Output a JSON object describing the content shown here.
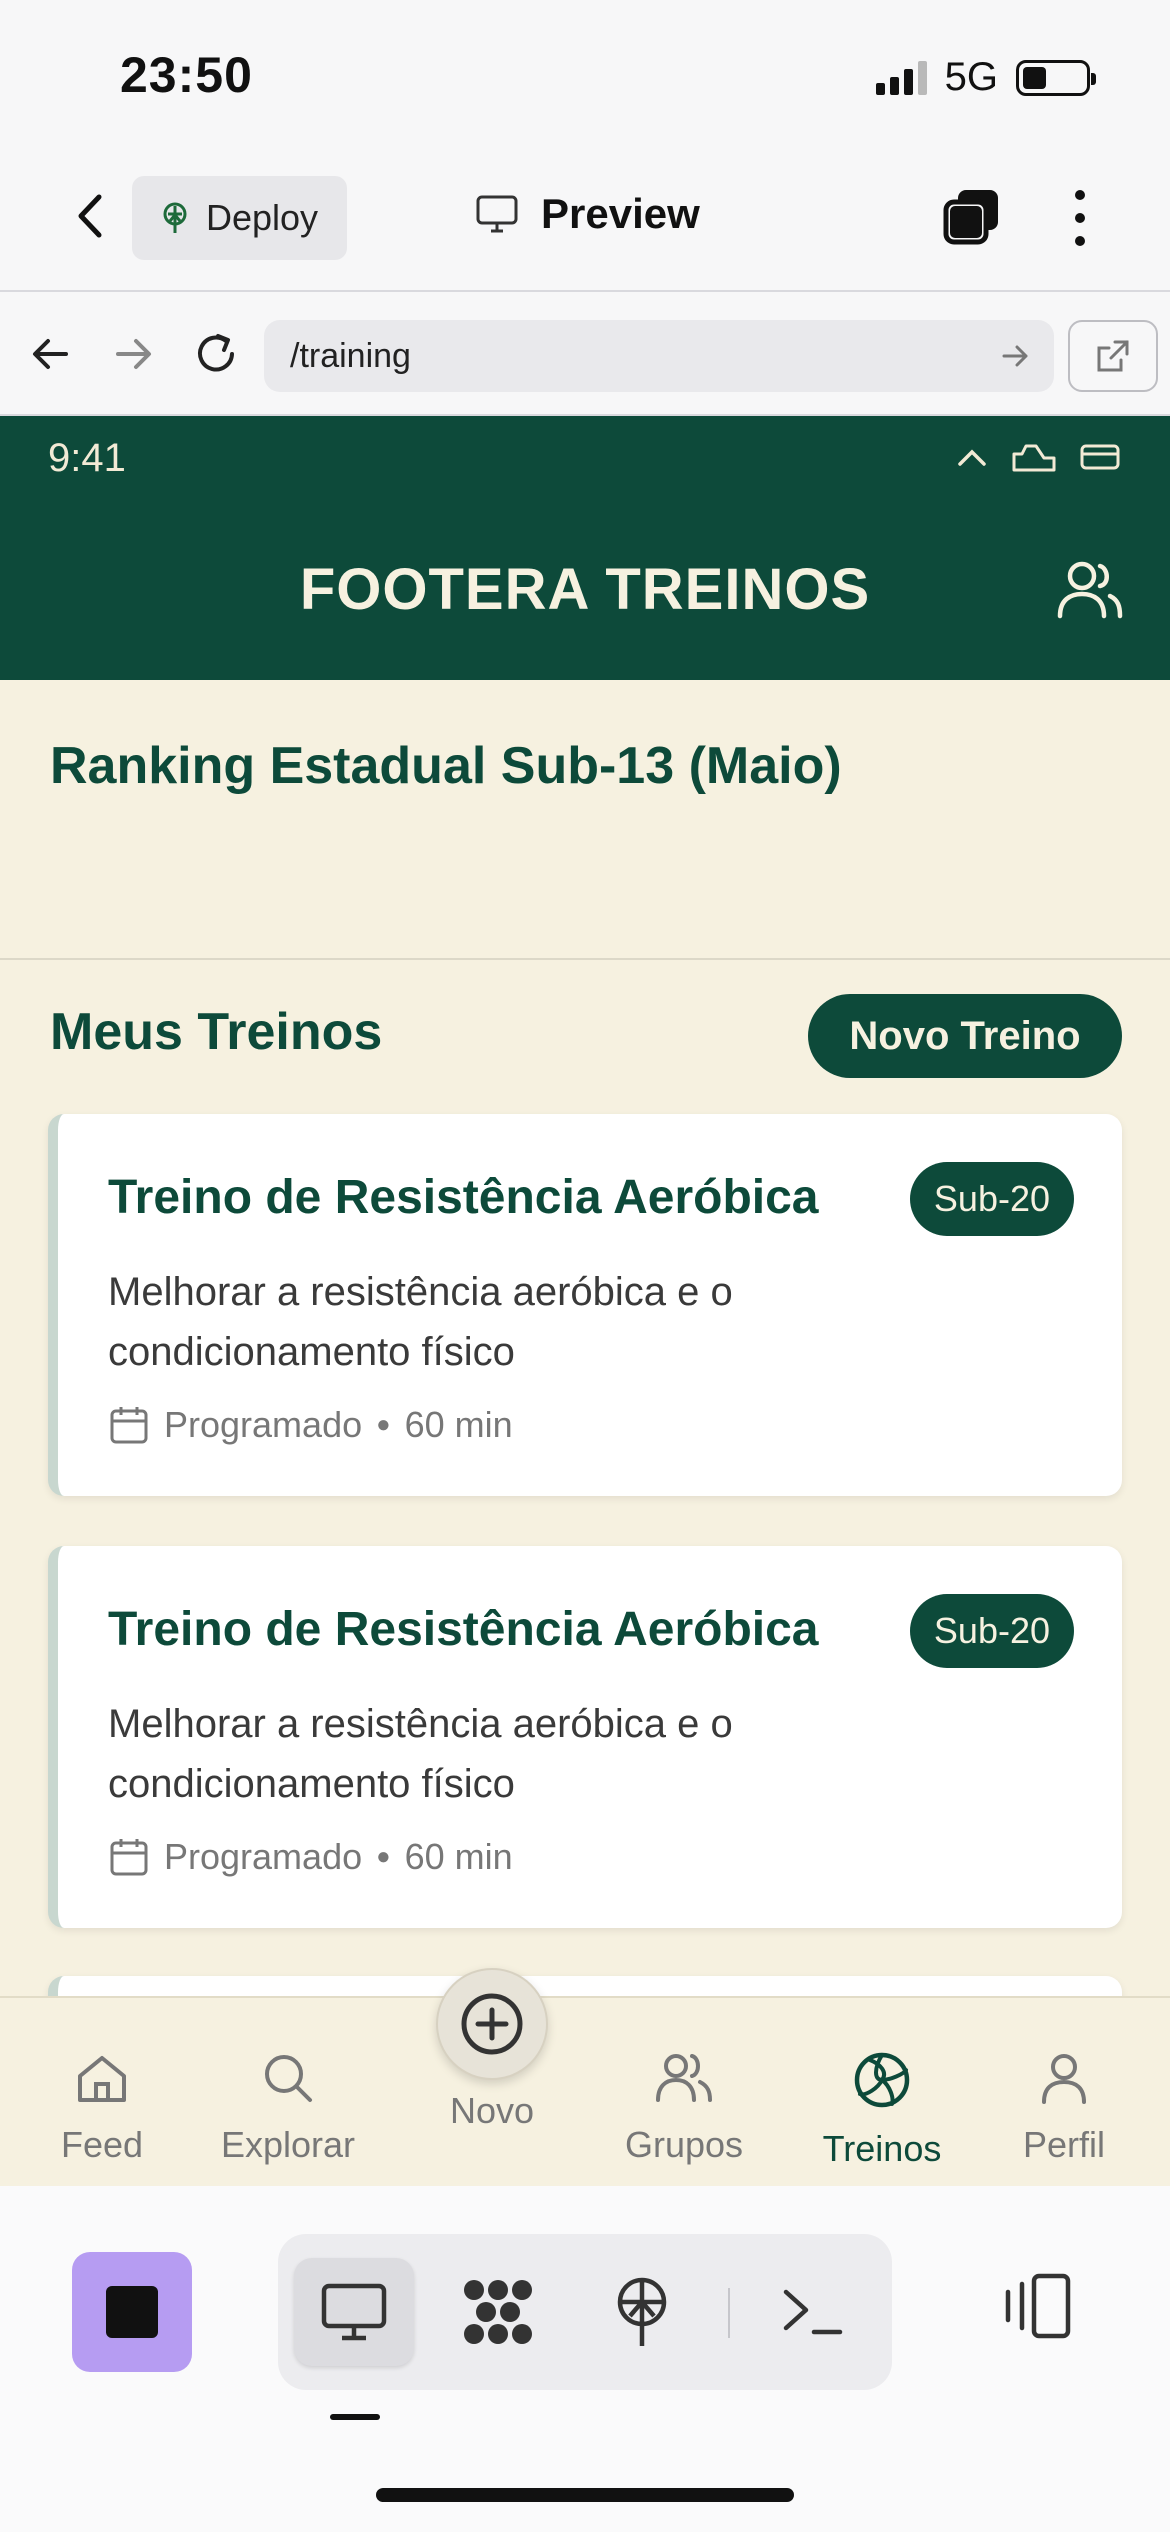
{
  "ios_status": {
    "time": "23:50",
    "network": "5G"
  },
  "toolbar": {
    "deploy_label": "Deploy",
    "preview_label": "Preview"
  },
  "urlbar": {
    "url": "/training"
  },
  "app": {
    "sim_time": "9:41",
    "title": "FOOTERA TREINOS",
    "ranking_title": "Ranking Estadual Sub-13 (Maio)",
    "section_title": "Meus Treinos",
    "new_button": "Novo Treino",
    "cards": [
      {
        "title": "Treino de Resistência Aeróbica",
        "badge": "Sub-20",
        "desc": "Melhorar a resistência aeróbica e o condicionamento físico",
        "status": "Programado",
        "duration": "60 min"
      },
      {
        "title": "Treino de Resistência Aeróbica",
        "badge": "Sub-20",
        "desc": "Melhorar a resistência aeróbica e o condicionamento físico",
        "status": "Programado",
        "duration": "60 min"
      }
    ],
    "nav": {
      "feed": "Feed",
      "explorar": "Explorar",
      "novo": "Novo",
      "grupos": "Grupos",
      "treinos": "Treinos",
      "perfil": "Perfil"
    }
  },
  "colors": {
    "brand_green": "#0d4a3a",
    "cream": "#f6f1e0",
    "stop_purple": "#b69cf2"
  }
}
